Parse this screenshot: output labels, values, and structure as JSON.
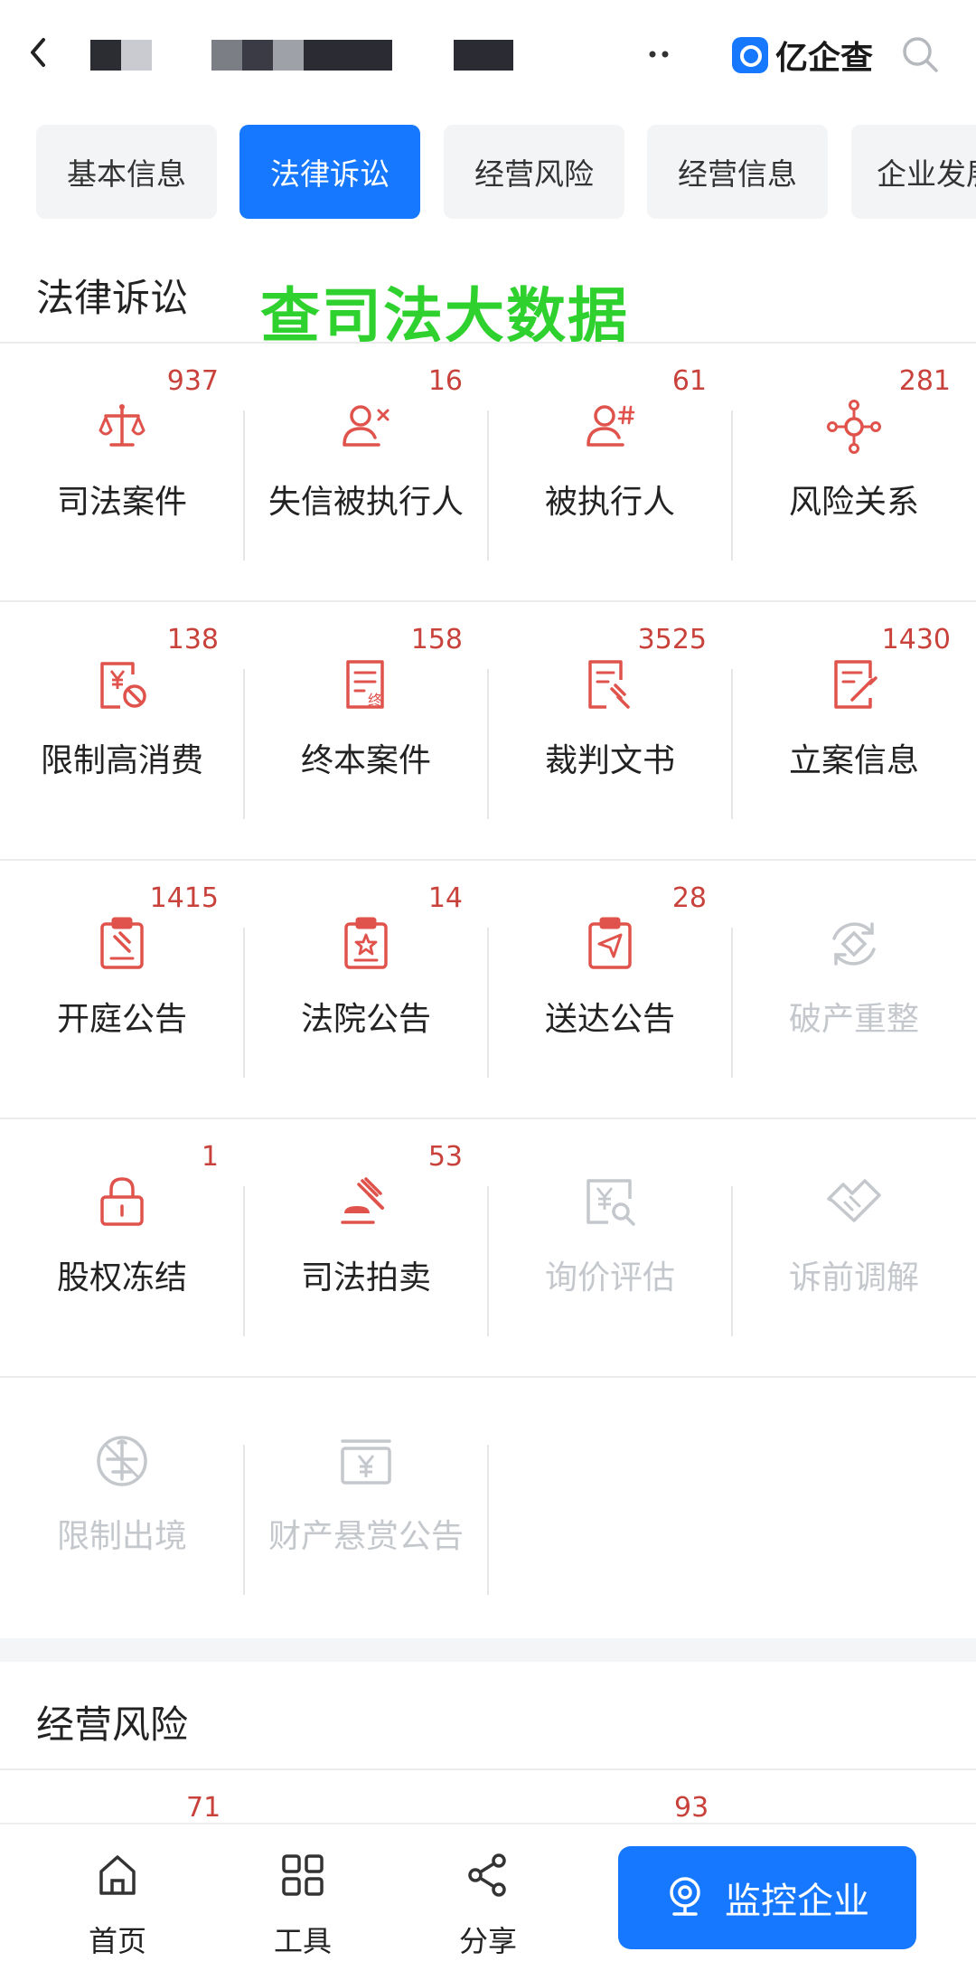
{
  "header": {
    "back_icon": "chevron-left-icon",
    "more_icon": "more-dots-icon",
    "brand_name": "亿企查",
    "search_icon": "search-icon"
  },
  "tabs": [
    {
      "label": "基本信息",
      "active": false
    },
    {
      "label": "法律诉讼",
      "active": true
    },
    {
      "label": "经营风险",
      "active": false
    },
    {
      "label": "经营信息",
      "active": false
    },
    {
      "label": "企业发展",
      "active": false
    }
  ],
  "legal": {
    "title": "法律诉讼",
    "overlay_text": "查司法大数据",
    "items": [
      {
        "label": "司法案件",
        "count": "937",
        "icon": "scale-icon",
        "enabled": true
      },
      {
        "label": "失信被执行人",
        "count": "16",
        "icon": "person-x-icon",
        "enabled": true
      },
      {
        "label": "被执行人",
        "count": "61",
        "icon": "person-hash-icon",
        "enabled": true
      },
      {
        "label": "风险关系",
        "count": "281",
        "icon": "network-icon",
        "enabled": true
      },
      {
        "label": "限制高消费",
        "count": "138",
        "icon": "yen-ban-icon",
        "enabled": true
      },
      {
        "label": "终本案件",
        "count": "158",
        "icon": "document-end-icon",
        "enabled": true
      },
      {
        "label": "裁判文书",
        "count": "3525",
        "icon": "document-gavel-icon",
        "enabled": true
      },
      {
        "label": "立案信息",
        "count": "1430",
        "icon": "document-edit-icon",
        "enabled": true
      },
      {
        "label": "开庭公告",
        "count": "1415",
        "icon": "clipboard-gavel-icon",
        "enabled": true
      },
      {
        "label": "法院公告",
        "count": "14",
        "icon": "clipboard-star-icon",
        "enabled": true
      },
      {
        "label": "送达公告",
        "count": "28",
        "icon": "clipboard-send-icon",
        "enabled": true
      },
      {
        "label": "破产重整",
        "count": "",
        "icon": "refresh-diamond-icon",
        "enabled": false
      },
      {
        "label": "股权冻结",
        "count": "1",
        "icon": "lock-icon",
        "enabled": true
      },
      {
        "label": "司法拍卖",
        "count": "53",
        "icon": "gavel-icon",
        "enabled": true
      },
      {
        "label": "询价评估",
        "count": "",
        "icon": "yen-search-icon",
        "enabled": false
      },
      {
        "label": "诉前调解",
        "count": "",
        "icon": "handshake-icon",
        "enabled": false
      },
      {
        "label": "限制出境",
        "count": "",
        "icon": "plane-ban-icon",
        "enabled": false
      },
      {
        "label": "财产悬赏公告",
        "count": "",
        "icon": "yen-board-icon",
        "enabled": false
      }
    ]
  },
  "risk": {
    "title": "经营风险",
    "counts": [
      "71",
      "93"
    ]
  },
  "bottom_nav": {
    "items": [
      {
        "label": "首页",
        "icon": "home-icon"
      },
      {
        "label": "工具",
        "icon": "grid-icon"
      },
      {
        "label": "分享",
        "icon": "share-icon"
      }
    ],
    "monitor_label": "监控企业",
    "monitor_icon": "location-pin-icon"
  },
  "colors": {
    "accent": "#1677ff",
    "icon_red": "#e0534c",
    "count_red": "#c8423b",
    "disabled": "#c4c8cc",
    "overlay_green": "#2fd12f"
  }
}
